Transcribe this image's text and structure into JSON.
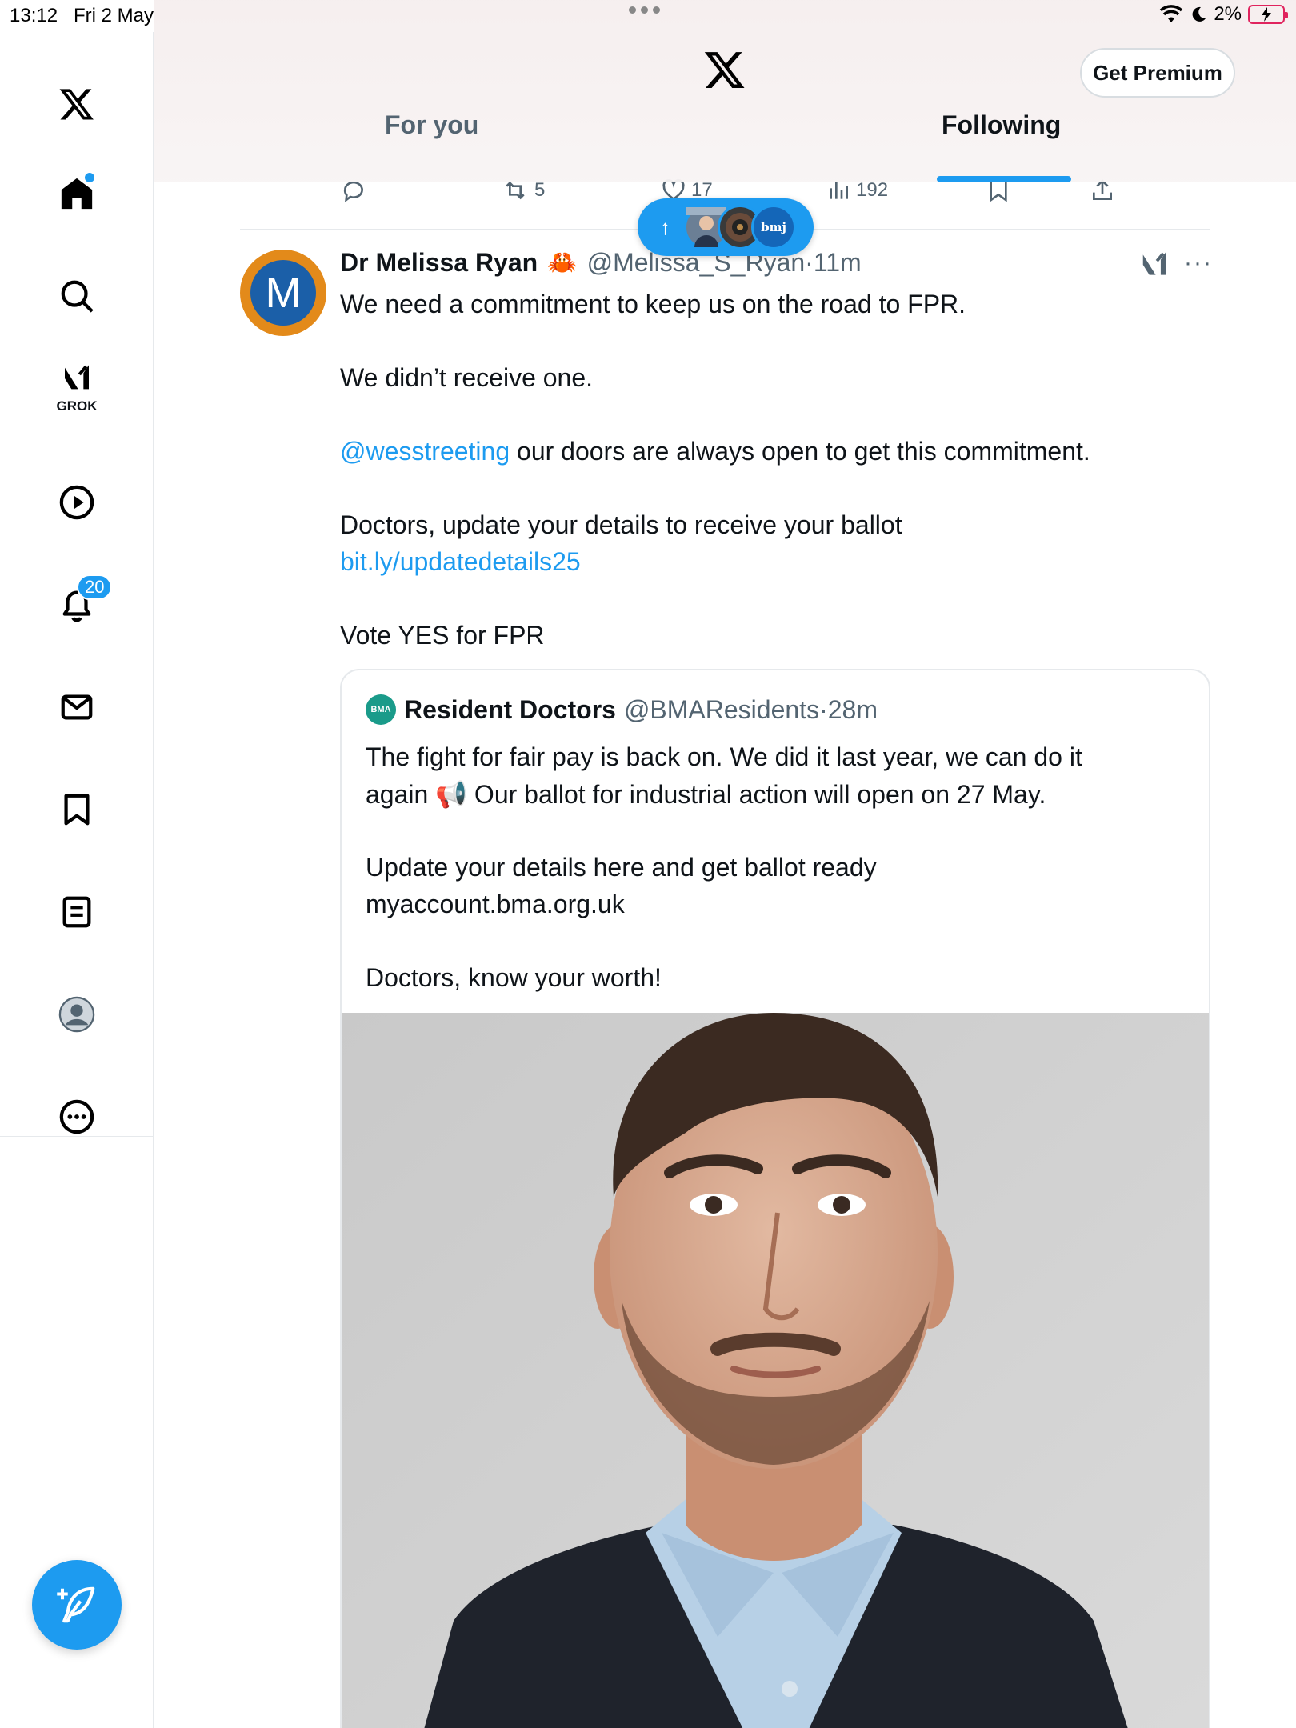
{
  "status_bar": {
    "time": "13:12",
    "date": "Fri 2 May",
    "battery": "2%"
  },
  "sidebar": {
    "grok_label": "GROK",
    "notifications_count": "20"
  },
  "header": {
    "premium_label": "Get Premium",
    "tabs": [
      {
        "label": "For you"
      },
      {
        "label": "Following"
      }
    ],
    "active_tab": "Following"
  },
  "prev_tweet_actions": {
    "reposts": "5",
    "likes": "17",
    "views": "192"
  },
  "new_posts_pill": {
    "label": "bmj"
  },
  "tweet": {
    "author_name": "Dr Melissa Ryan",
    "author_emoji": "🦀",
    "handle": "@Melissa_S_Ryan",
    "separator": "·",
    "time": "11m",
    "avatar_letter": "M",
    "line1": "We need a commitment to keep us on the road to FPR.",
    "line2": "We didn’t receive one.",
    "mention": "@wesstreeting",
    "line3_rest": " our doors are always open to get this commitment.",
    "line4": "Doctors, update your details to receive your ballot",
    "link": "bit.ly/updatedetails25",
    "line5": "Vote YES for FPR"
  },
  "quote": {
    "badge": "BMA",
    "author_name": "Resident Doctors",
    "handle": "@BMAResidents",
    "separator": "·",
    "time": "28m",
    "line1": "The fight for fair pay is back on. We did it last year, we can do it",
    "line2": "again 📢 Our ballot for industrial action will open on 27 May.",
    "line3": "Update your details here and get ballot ready",
    "line4": "myaccount.bma.org.uk",
    "line5": "Doctors, know your worth!"
  },
  "colors": {
    "accent": "#1d9bf0",
    "text": "#0f1419",
    "secondary": "#536471",
    "border": "#e6e9ec"
  }
}
